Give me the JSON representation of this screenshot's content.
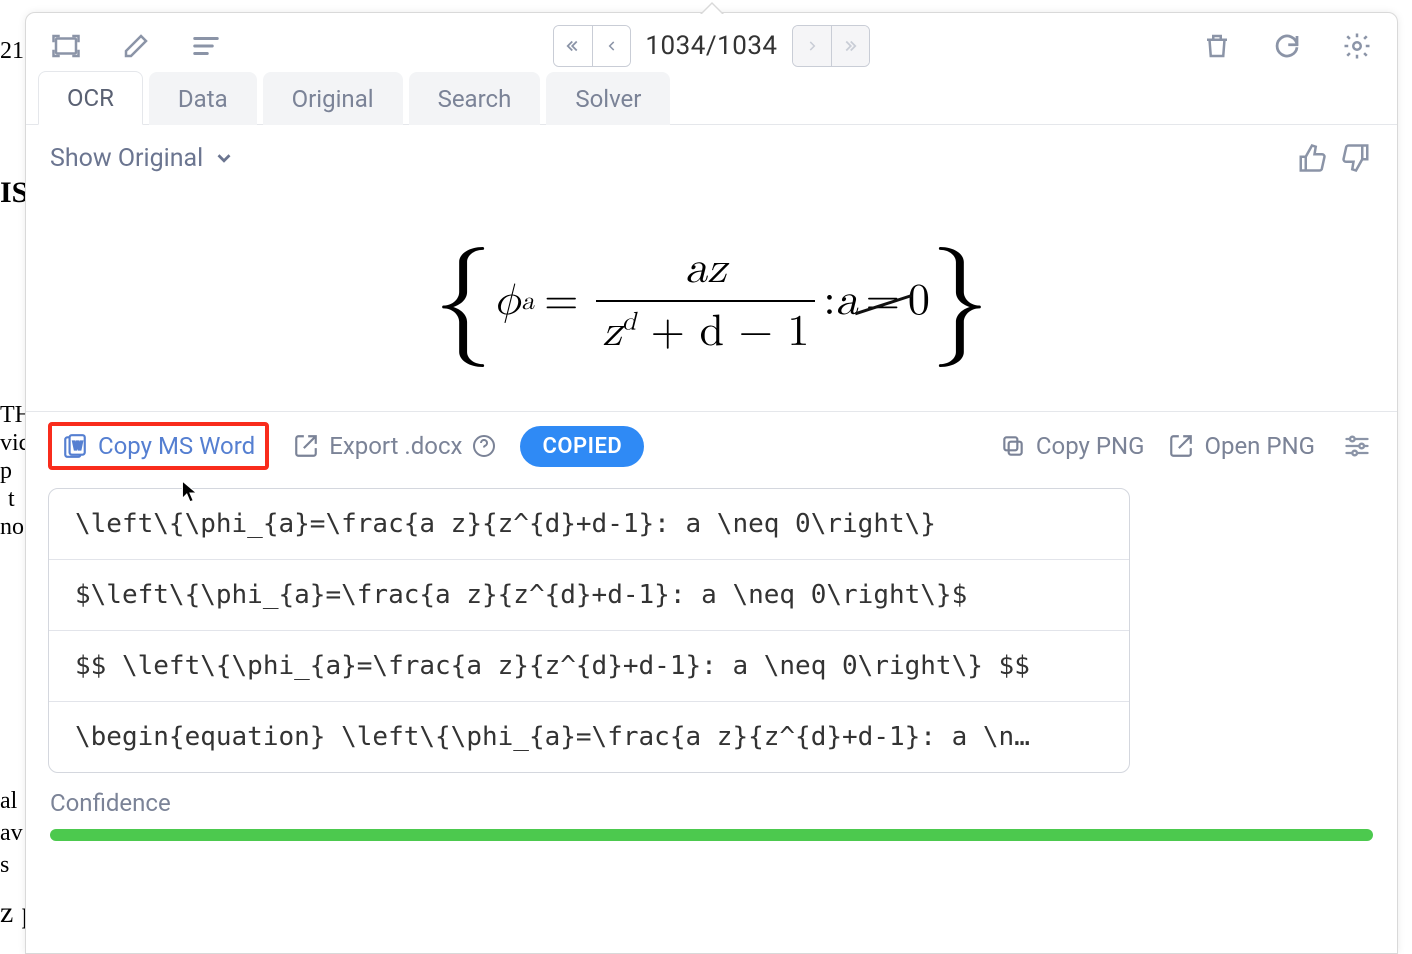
{
  "bg": {
    "t1": "21",
    "t2": "IS",
    "t3": "TH",
    "t4": "vic",
    "t5": "p",
    "t6": "t",
    "t7": "no",
    "t8": "al",
    "t9": "av",
    "t10": "s",
    "bottom": "z points for a fixed degree d and a fixed dynamical portrait (m, n) are roots of a"
  },
  "toolbar": {
    "page_indicator": "1034/1034"
  },
  "tabs": {
    "ocr": "OCR",
    "data": "Data",
    "original": "Original",
    "search": "Search",
    "solver": "Solver"
  },
  "subbar": {
    "show_original": "Show Original"
  },
  "actions": {
    "copy_word": "Copy MS Word",
    "export_docx": "Export .docx",
    "copied": "COPIED",
    "copy_png": "Copy PNG",
    "open_png": "Open PNG"
  },
  "latex": {
    "r1": "\\left\\{\\phi_{a}=\\frac{a z}{z^{d}+d-1}: a \\neq 0\\right\\}",
    "r2": "$\\left\\{\\phi_{a}=\\frac{a z}{z^{d}+d-1}: a \\neq 0\\right\\}$",
    "r3": "$$ \\left\\{\\phi_{a}=\\frac{a z}{z^{d}+d-1}: a \\neq 0\\right\\} $$",
    "r4": "\\begin{equation} \\left\\{\\phi_{a}=\\frac{a z}{z^{d}+d-1}: a \\n…"
  },
  "confidence": {
    "label": "Confidence"
  },
  "formula": {
    "phi": "ϕ",
    "sub": "a",
    "eq": "=",
    "num": "az",
    "den_z": "z",
    "den_sup": "d",
    "den_rest": " + d − 1",
    "colon": " : ",
    "a": "a",
    "neq": "=",
    "zero": "0"
  }
}
